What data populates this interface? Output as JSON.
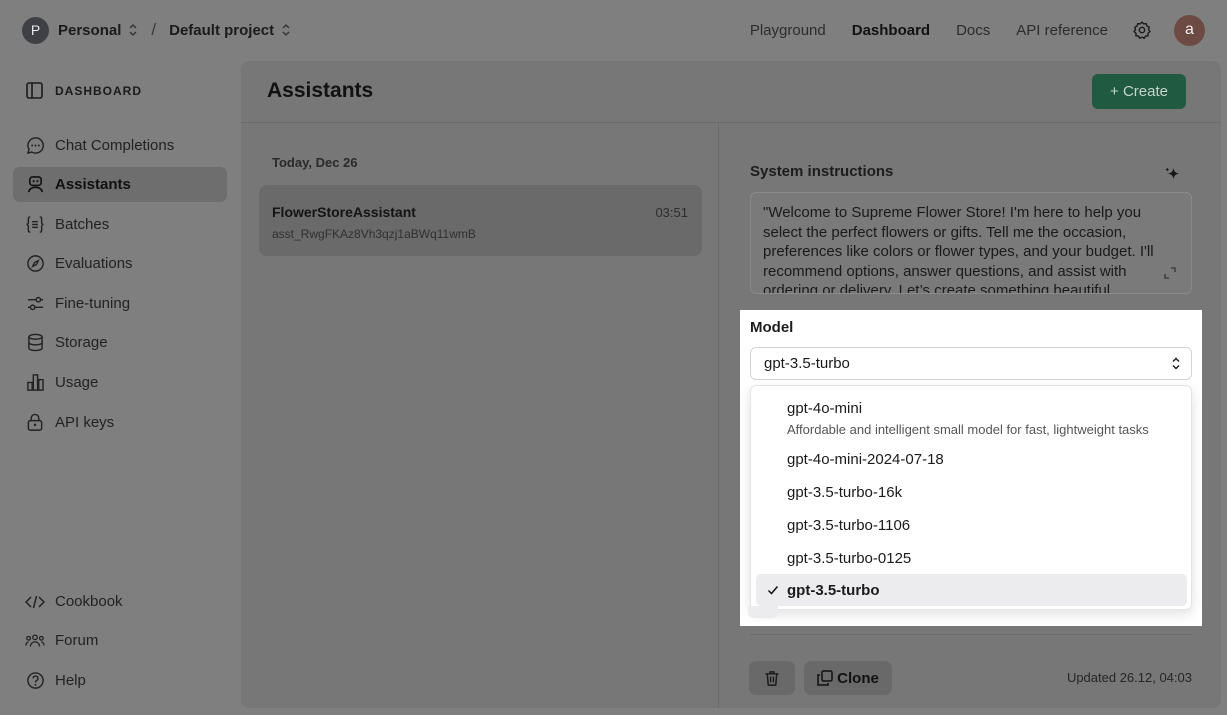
{
  "topbar": {
    "org_initial": "P",
    "org_name": "Personal",
    "project_name": "Default project",
    "nav": [
      "Playground",
      "Dashboard",
      "Docs",
      "API reference"
    ],
    "active_nav": "Dashboard",
    "user_initial": "a"
  },
  "sidebar": {
    "title": "DASHBOARD",
    "items": [
      {
        "label": "Chat Completions",
        "icon": "chat-bubble-icon"
      },
      {
        "label": "Assistants",
        "icon": "robot-icon"
      },
      {
        "label": "Batches",
        "icon": "braces-list-icon"
      },
      {
        "label": "Evaluations",
        "icon": "compass-icon"
      },
      {
        "label": "Fine-tuning",
        "icon": "sliders-icon"
      },
      {
        "label": "Storage",
        "icon": "database-icon"
      },
      {
        "label": "Usage",
        "icon": "bar-chart-icon"
      },
      {
        "label": "API keys",
        "icon": "lock-icon"
      }
    ],
    "active_item": "Assistants",
    "footer": [
      {
        "label": "Cookbook",
        "icon": "code-icon"
      },
      {
        "label": "Forum",
        "icon": "people-icon"
      },
      {
        "label": "Help",
        "icon": "help-icon"
      }
    ]
  },
  "main": {
    "title": "Assistants",
    "create_label": "+ Create",
    "list": {
      "date_heading": "Today, Dec 26",
      "assistant": {
        "name": "FlowerStoreAssistant",
        "id": "asst_RwgFKAz8Vh3qzj1aBWq11wmB",
        "time": "03:51"
      }
    },
    "detail": {
      "instructions_label": "System instructions",
      "instructions_text": "\"Welcome to Supreme Flower Store! I'm here to help you select the perfect flowers or gifts. Tell me the occasion, preferences like colors or flower types, and your budget. I'll recommend options, answer questions, and assist with ordering or delivery. Let’s create something beautiful together!\"",
      "model_label": "Model",
      "model_value": "gpt-3.5-turbo",
      "model_options": [
        {
          "label": "gpt-4o-mini",
          "description": "Affordable and intelligent small model for fast, lightweight tasks"
        },
        {
          "label": "gpt-4o-mini-2024-07-18"
        },
        {
          "label": "gpt-3.5-turbo-16k"
        },
        {
          "label": "gpt-3.5-turbo-1106"
        },
        {
          "label": "gpt-3.5-turbo-0125"
        },
        {
          "label": "gpt-3.5-turbo",
          "selected": true
        }
      ],
      "clone_label": "Clone",
      "updated_text": "Updated 26.12, 04:03"
    }
  },
  "colors": {
    "create_button": "#1f5a41",
    "overlay_panel": "#ffffff",
    "selected_option_bg": "#ececee"
  }
}
